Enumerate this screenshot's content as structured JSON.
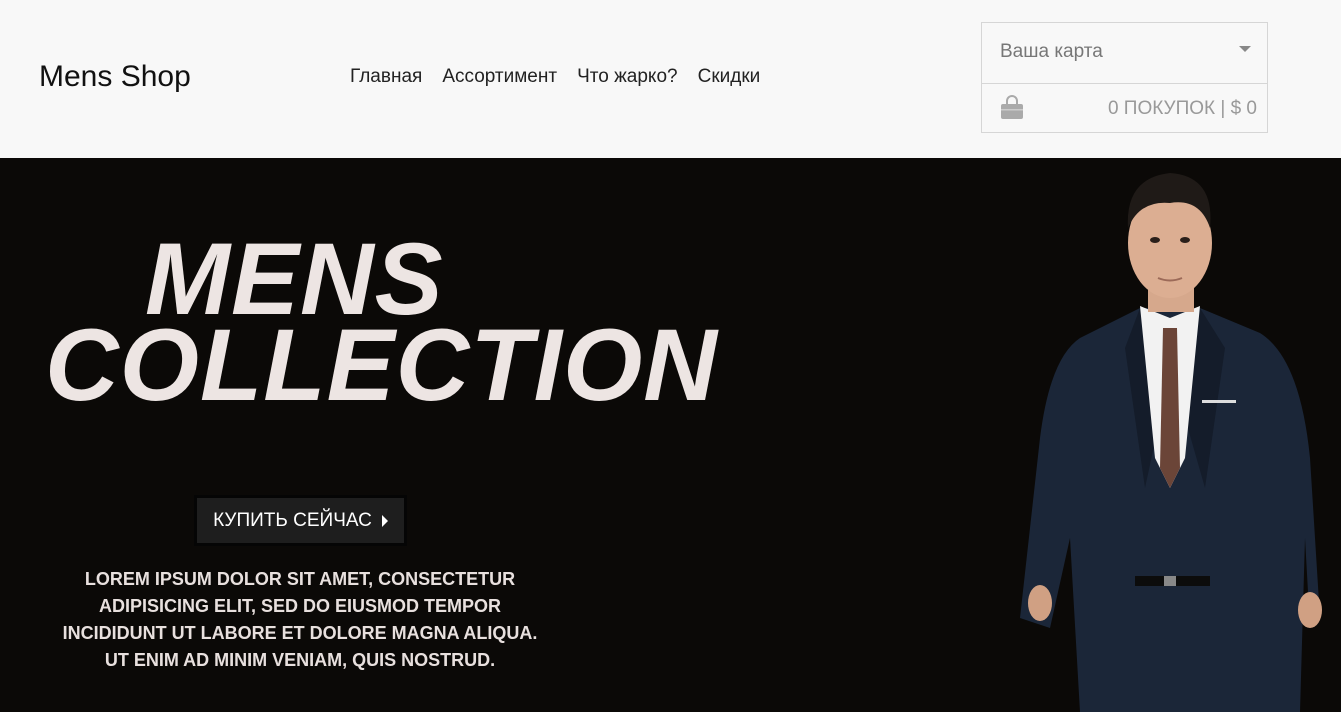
{
  "header": {
    "logo": "Mens Shop",
    "nav": [
      "Главная",
      "Ассортимент",
      "Что жарко?",
      "Скидки"
    ],
    "cart": {
      "select_label": "Ваша карта",
      "summary": "0 ПОКУПОК | $ 0",
      "icon": "shopping-bag-icon"
    }
  },
  "hero": {
    "title_line1": "MENS",
    "title_line2": "COLLECTION",
    "button_label": "КУПИТЬ СЕЙЧАС",
    "description": "LOREM IPSUM DOLOR SIT AMET, CONSECTETUR ADIPISICING ELIT, SED DO EIUSMOD TEMPOR INCIDIDUNT UT LABORE ET DOLORE MAGNA ALIQUA. UT ENIM AD MINIM VENIAM, QUIS NOSTRUD."
  },
  "colors": {
    "header_bg": "#f8f8f8",
    "hero_bg": "#0b0907",
    "hero_text": "#ede5e3",
    "button_bg": "#1e1e1e"
  }
}
